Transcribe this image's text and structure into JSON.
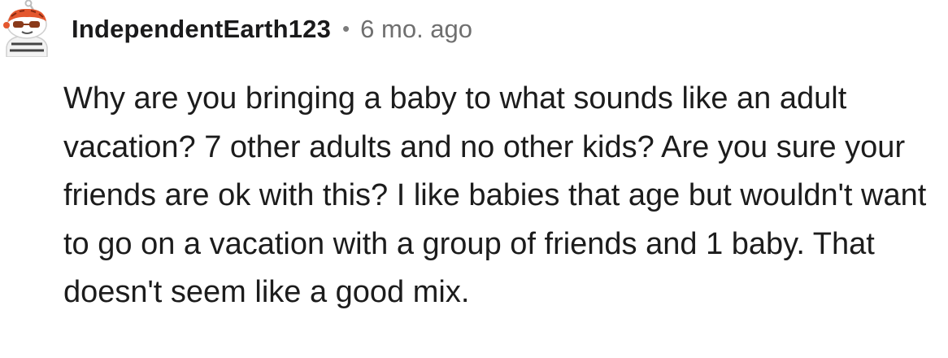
{
  "comment": {
    "avatar_icon": "snoo-avatar-icon",
    "username": "IndependentEarth123",
    "separator": "•",
    "timestamp": "6 mo. ago",
    "body": "Why are you bringing a baby to what sounds like an adult vacation? 7 other adults and no other kids? Are you sure your friends are ok with this? I like babies that age but wouldn't want to go on a vacation with a group of friends and 1 baby. That doesn't seem like a good mix."
  },
  "colors": {
    "username": "#1a1a1b",
    "meta": "#6f6f6f",
    "body": "#1c1c1c",
    "avatar_accent": "#e4572e"
  }
}
